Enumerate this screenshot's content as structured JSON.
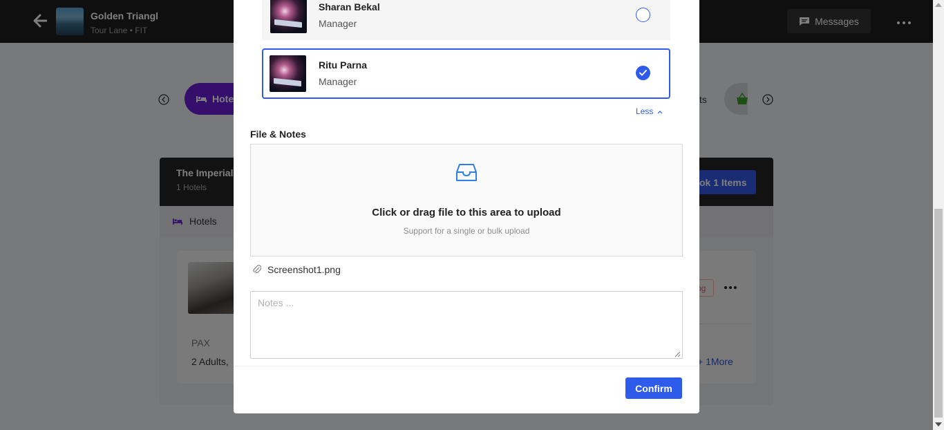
{
  "topbar": {
    "tour_title": "Golden Triangl",
    "tour_subtitle": "Tour Lane • FIT",
    "messages_label": "Messages"
  },
  "tabs": {
    "hotels_label": "Hote",
    "partial_tab_label": "ts"
  },
  "booking_card": {
    "title": "The Imperial,",
    "subtitle": "1 Hotels",
    "book_button_label": "ok 1 Items",
    "section_label": "Hotels",
    "pax_label": "PAX",
    "pax_value": "2 Adults,",
    "status_tag": "ng",
    "more_link": "+ 1More"
  },
  "modal": {
    "users": [
      {
        "name": "Sharan Bekal",
        "role": "Manager",
        "selected": false
      },
      {
        "name": "Ritu Parna",
        "role": "Manager",
        "selected": true
      }
    ],
    "less_link": "Less",
    "files_section_title": "File & Notes",
    "upload_text": "Click or drag file to this area to upload",
    "upload_hint": "Support for a single or bulk upload",
    "attached_file": "Screenshot1.png",
    "notes_placeholder": "Notes ...",
    "confirm_label": "Confirm"
  },
  "colors": {
    "primary": "#2f5bea",
    "hotels_tab": "#6a1fd6",
    "topbar": "#1f1f1f"
  }
}
